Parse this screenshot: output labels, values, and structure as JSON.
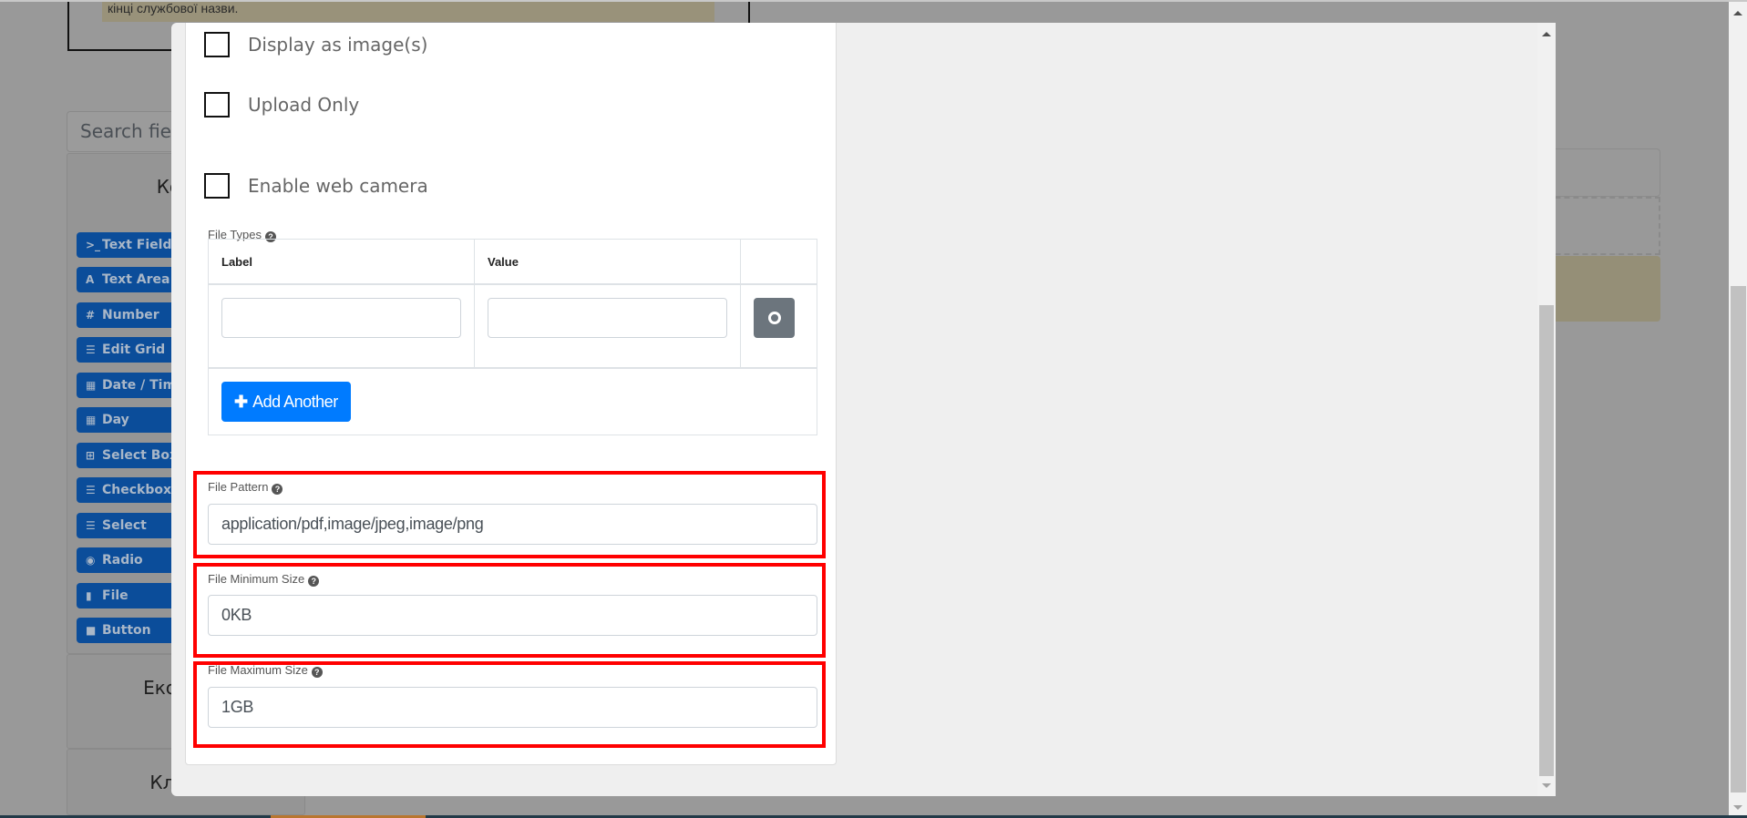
{
  "background": {
    "note_text": "кінці службової назви.",
    "search_placeholder": "Search fie",
    "panels": [
      {
        "title": "Комп"
      },
      {
        "title": "Експер"
      },
      {
        "title": "Кла"
      }
    ],
    "components": [
      {
        "icon": "terminal-icon",
        "glyph": ">_",
        "label": "Text Field"
      },
      {
        "icon": "font-icon",
        "glyph": "A",
        "label": "Text Area"
      },
      {
        "icon": "hashtag-icon",
        "glyph": "#",
        "label": "Number"
      },
      {
        "icon": "tasks-icon",
        "glyph": "☰",
        "label": "Edit Grid"
      },
      {
        "icon": "calendar-icon",
        "glyph": "▦",
        "label": "Date / Tim"
      },
      {
        "icon": "calendar-icon",
        "glyph": "▦",
        "label": "Day"
      },
      {
        "icon": "plus-square-icon",
        "glyph": "⊞",
        "label": "Select Box"
      },
      {
        "icon": "list-icon",
        "glyph": "☰",
        "label": "Checkbox"
      },
      {
        "icon": "th-list-icon",
        "glyph": "☰",
        "label": "Select"
      },
      {
        "icon": "dot-circle-icon",
        "glyph": "◉",
        "label": "Radio"
      },
      {
        "icon": "file-icon",
        "glyph": "▮",
        "label": "File"
      },
      {
        "icon": "stop-icon",
        "glyph": "■",
        "label": "Button"
      }
    ]
  },
  "modal": {
    "checkboxes": [
      {
        "label": "Display as image(s)",
        "checked": false
      },
      {
        "label": "Upload Only",
        "checked": false
      },
      {
        "label": "Enable web camera",
        "checked": false
      }
    ],
    "file_types": {
      "label": "File Types",
      "columns": [
        "Label",
        "Value",
        ""
      ],
      "rows": [
        {
          "label": "",
          "value": ""
        }
      ],
      "add_button": "Add Another"
    },
    "file_pattern": {
      "label": "File Pattern",
      "value": "application/pdf,image/jpeg,image/png"
    },
    "file_min_size": {
      "label": "File Minimum Size",
      "value": "0KB"
    },
    "file_max_size": {
      "label": "File Maximum Size",
      "value": "1GB"
    }
  },
  "colors": {
    "primary": "#007bff",
    "secondary": "#6c757d",
    "highlight": "#ff0000",
    "component_button": "#0b4d9a"
  }
}
